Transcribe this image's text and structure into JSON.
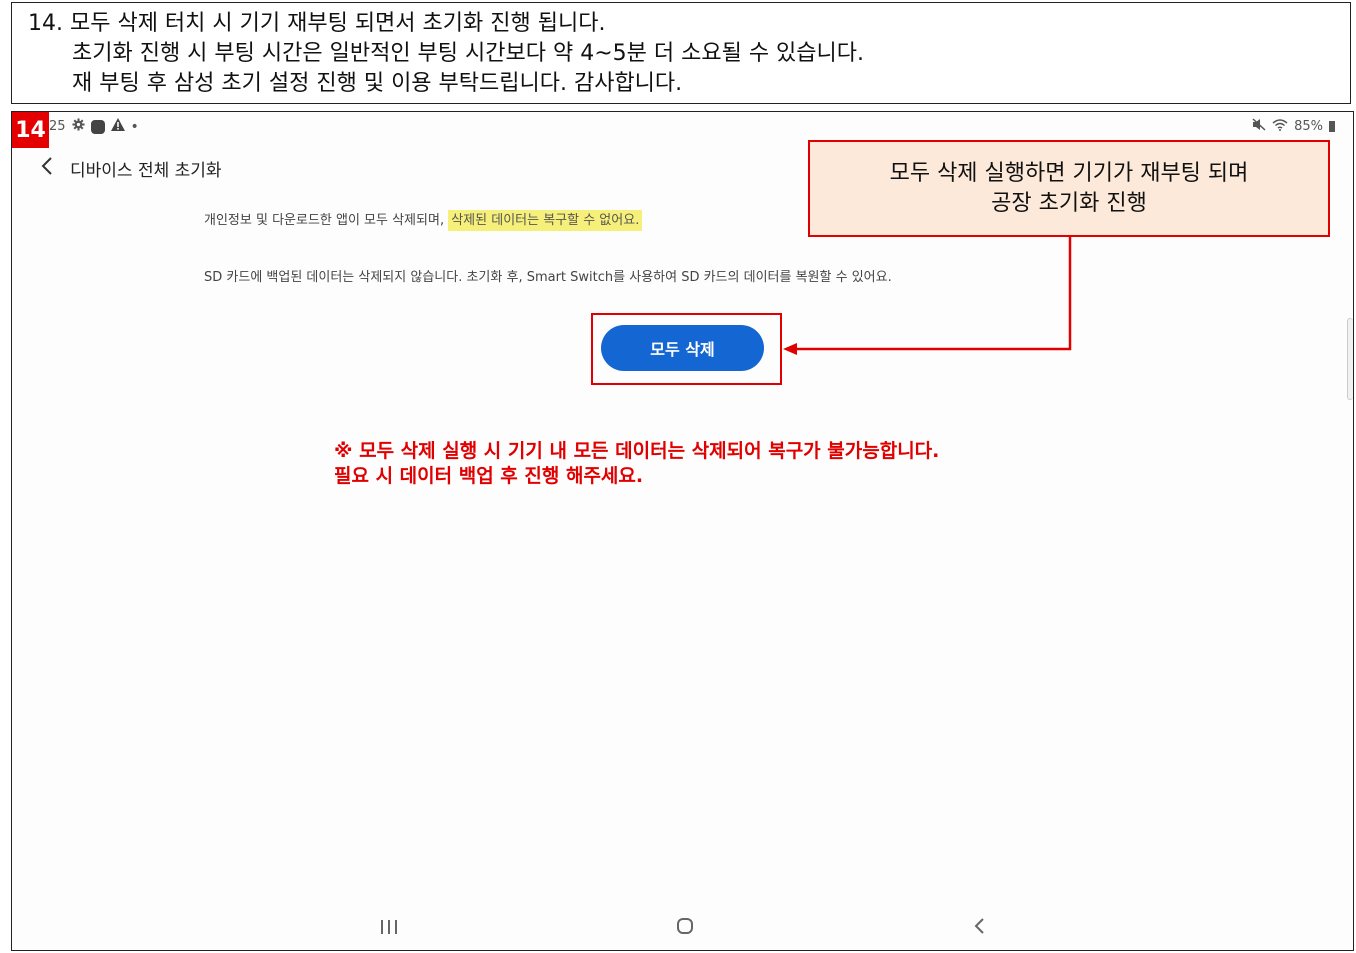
{
  "instructions": {
    "line1": "14. 모두 삭제 터치 시 기기 재부팅 되면서 초기화 진행 됩니다.",
    "line2": "초기화 진행 시 부팅 시간은 일반적인 부팅 시간보다 약 4~5분 더 소요될 수 있습니다.",
    "line3": "재 부팅 후 삼성 초기 설정 진행 및 이용 부탁드립니다. 감사합니다."
  },
  "step_badge": "14",
  "status_bar": {
    "time": "25",
    "battery": "85%",
    "icons": [
      "settings-icon",
      "circle-icon",
      "alert-icon",
      "mute-icon",
      "wifi-icon",
      "battery-icon"
    ]
  },
  "header": {
    "title": "디바이스 전체 초기화"
  },
  "content": {
    "para1_plain": "개인정보 및 다운로드한 앱이 모두 삭제되며, ",
    "para1_highlight": "삭제된 데이터는 복구할 수 없어요.",
    "para2": "SD 카드에 백업된 데이터는 삭제되지 않습니다. 초기화 후, Smart Switch를 사용하여 SD 카드의 데이터를 복원할 수 있어요.",
    "delete_button": "모두 삭제"
  },
  "callout": {
    "line1": "모두 삭제 실행하면 기기가 재부팅 되며",
    "line2": "공장 초기화 진행"
  },
  "warning": {
    "line1": "※ 모두 삭제 실행 시 기기 내 모든 데이터는 삭제되어 복구가 불가능합니다.",
    "line2": "필요 시 데이터 백업 후 진행 해주세요."
  },
  "colors": {
    "annotation_red": "#e00000",
    "button_blue": "#1466d2",
    "highlight_yellow": "#f6f07a",
    "callout_bg": "#fce9d9"
  }
}
